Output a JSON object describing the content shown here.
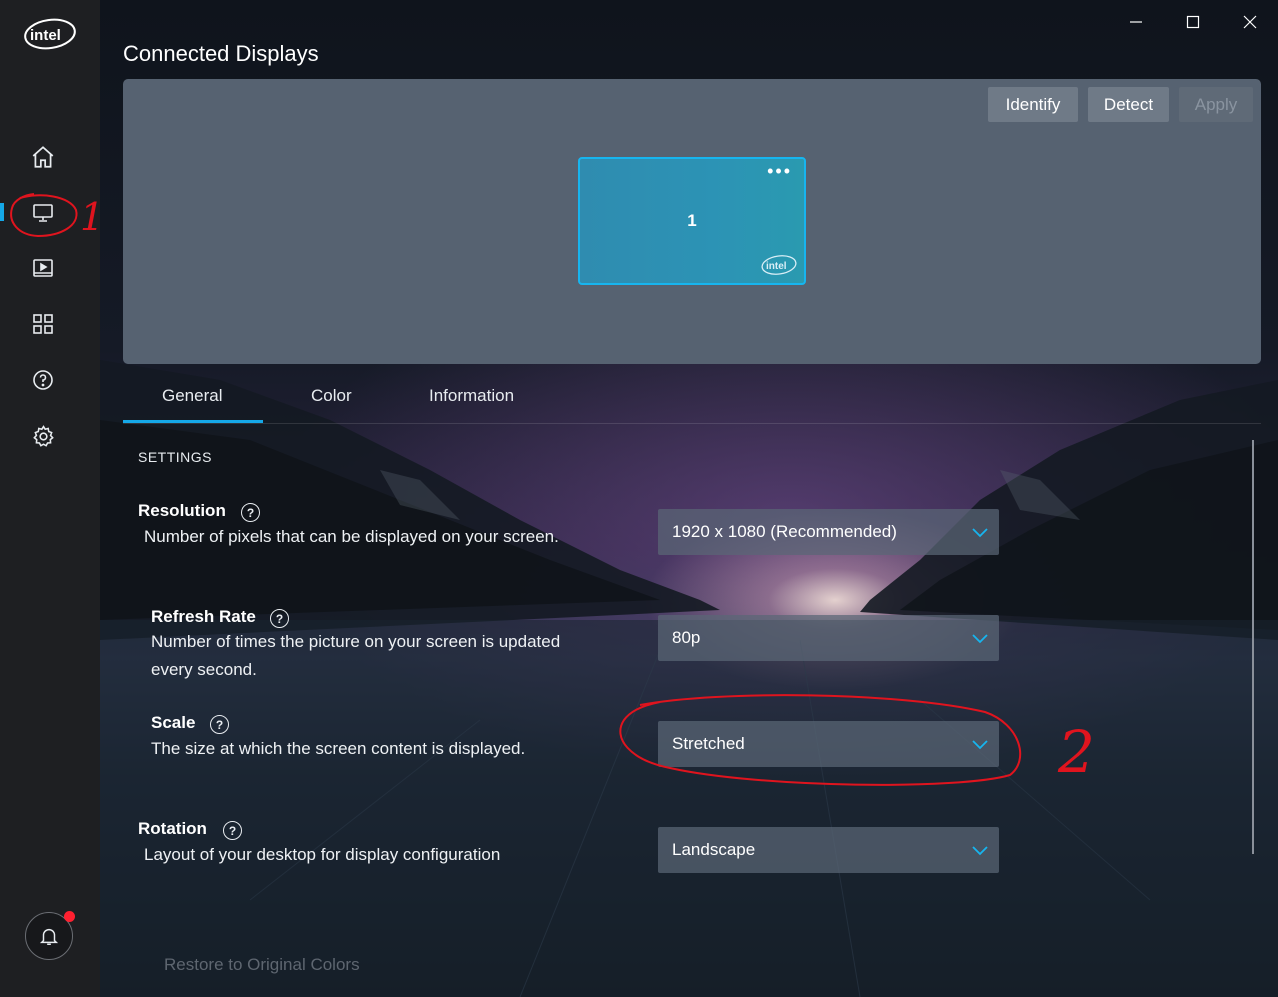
{
  "app": {
    "logo_text": "intel"
  },
  "window_controls": {
    "minimize": "—",
    "maximize": "☐",
    "close": "✕"
  },
  "page": {
    "title": "Connected Displays"
  },
  "display_panel": {
    "buttons": {
      "identify": "Identify",
      "detect": "Detect",
      "apply": "Apply"
    },
    "monitor": {
      "number": "1",
      "menu": "•••",
      "logo_text": "intel"
    }
  },
  "tabs": [
    {
      "label": "General",
      "active": true
    },
    {
      "label": "Color",
      "active": false
    },
    {
      "label": "Information",
      "active": false
    }
  ],
  "settings": {
    "section_label": "SETTINGS",
    "resolution": {
      "title": "Resolution",
      "description": "Number of pixels that can be displayed on your screen.",
      "value": "1920 x 1080 (Recommended)"
    },
    "refresh_rate": {
      "title": "Refresh Rate",
      "description_line1": "Number of times the picture on your screen is updated",
      "description_line2": "every second.",
      "value": "80p"
    },
    "scale": {
      "title": "Scale",
      "description": "The size at which the screen content is displayed.",
      "value": "Stretched"
    },
    "rotation": {
      "title": "Rotation",
      "description": "Layout of your desktop for display configuration",
      "value": "Landscape"
    }
  },
  "footer": {
    "restore_link": "Restore to Original Colors"
  },
  "help_glyph": "?",
  "annotations": {
    "mark1": "1",
    "mark2": "2"
  },
  "colors": {
    "accent": "#15a8e8",
    "annotation": "#e0141e",
    "notification_dot": "#ff2030"
  }
}
